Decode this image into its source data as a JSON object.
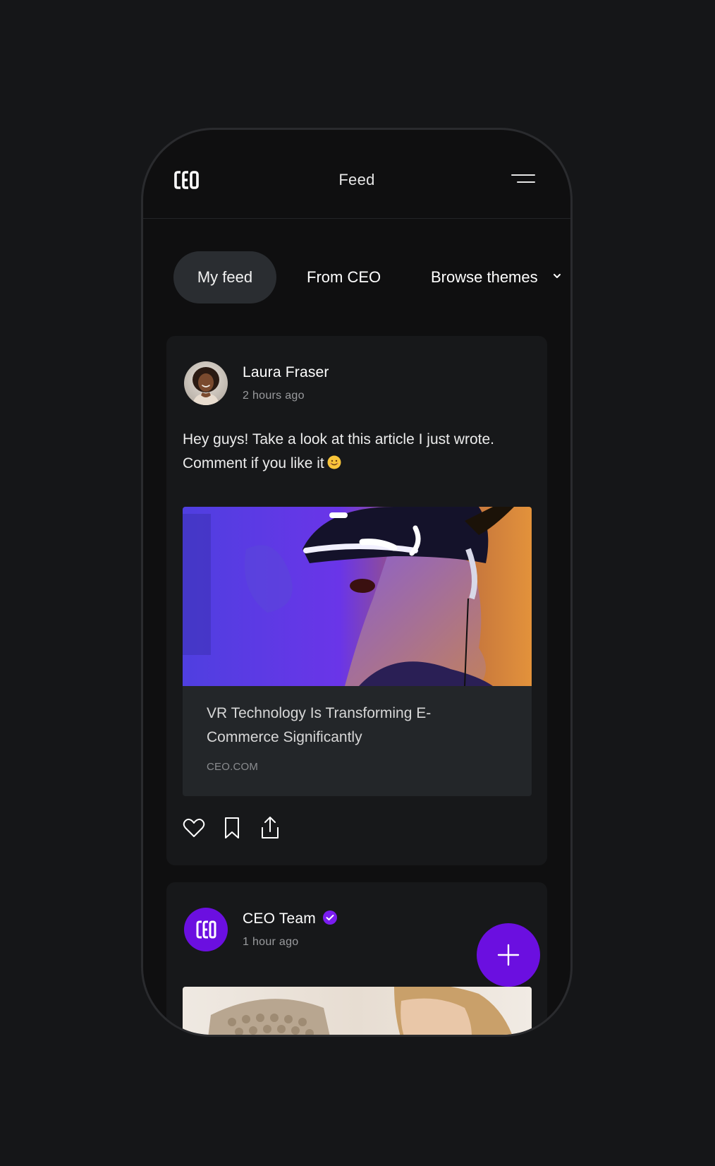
{
  "header": {
    "logo_text": "ceo",
    "title": "Feed",
    "menu_icon": "hamburger-menu-icon"
  },
  "tabs": [
    {
      "label": "My feed",
      "active": true
    },
    {
      "label": "From CEO",
      "active": false
    },
    {
      "label": "Browse themes",
      "active": false,
      "dropdown_icon": "chevron-down-icon"
    }
  ],
  "posts": [
    {
      "author": "Laura Fraser",
      "time": "2 hours ago",
      "text": "Hey guys! Take a look at this article I just wrote. Comment if you like it",
      "emoji": "smiling-face-emoji",
      "link": {
        "title": "VR Technology Is Transforming E-Commerce Significantly",
        "domain": "CEO.COM",
        "image": "person-wearing-vr-headset"
      },
      "actions": [
        "heart-icon",
        "bookmark-icon",
        "share-icon"
      ]
    },
    {
      "author": "CEO Team",
      "time": "1 hour ago",
      "verified": true,
      "avatar_text": "ceo",
      "image": "woman-with-knitted-hat"
    }
  ],
  "fab": {
    "icon": "plus-icon"
  },
  "colors": {
    "background": "#151618",
    "phone": "#0f0f10",
    "card": "#17181a",
    "active_tab": "#2a2d31",
    "link_preview": "#232629",
    "accent": "#6b0fe0"
  }
}
